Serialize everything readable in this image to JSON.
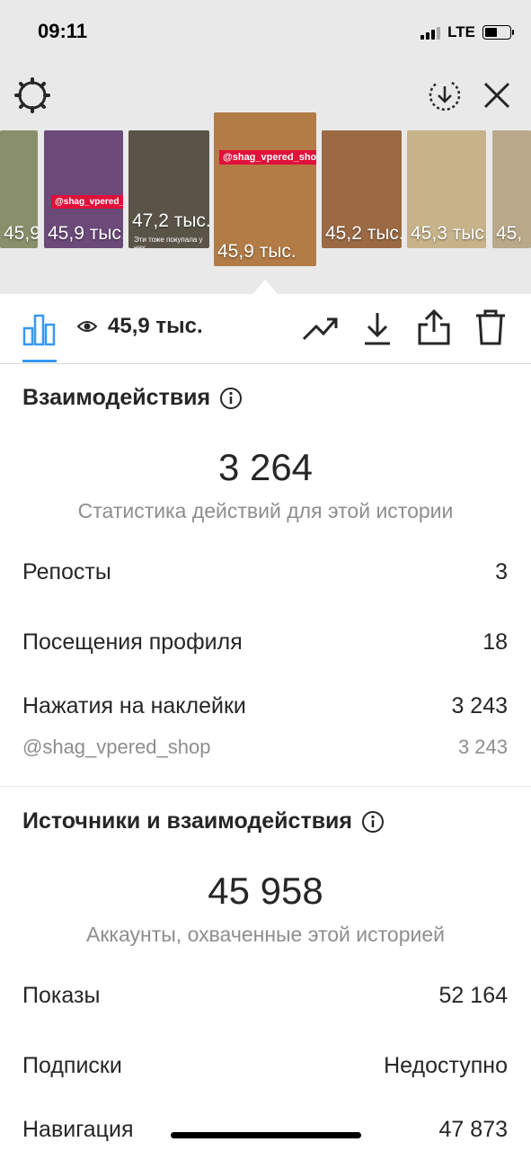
{
  "status_bar": {
    "time": "09:11",
    "network": "LTE"
  },
  "stories": [
    {
      "views": "45,9 тыс.",
      "bg": "#8a8f6b"
    },
    {
      "views": "45,9 тыс.",
      "bg": "#6b4a7a",
      "tag": "@shag_vpered_shop"
    },
    {
      "views": "47,2 тыс.",
      "bg": "#5a5448",
      "caption": "Эти тоже покупала у них"
    },
    {
      "views": "45,9 тыс.",
      "bg": "#b37b45",
      "tag": "@shag_vpered_shop",
      "active": true
    },
    {
      "views": "45,2 тыс.",
      "bg": "#9b6a44"
    },
    {
      "views": "45,3 тыс.",
      "bg": "#c7b38a"
    },
    {
      "views": "45,",
      "bg": "#b9a98a"
    }
  ],
  "toolbar": {
    "views": "45,9 тыс."
  },
  "interactions": {
    "title": "Взаимодействия",
    "total": "3 264",
    "subtitle": "Статистика действий для этой истории",
    "rows": [
      {
        "label": "Репосты",
        "value": "3"
      },
      {
        "label": "Посещения профиля",
        "value": "18"
      },
      {
        "label": "Нажатия на наклейки",
        "value": "3 243"
      }
    ],
    "sticker_detail": {
      "label": "@shag_vpered_shop",
      "value": "3 243"
    }
  },
  "discovery": {
    "title": "Источники и взаимодействия",
    "total": "45 958",
    "subtitle": "Аккаунты, охваченные этой историей",
    "rows": [
      {
        "label": "Показы",
        "value": "52 164"
      },
      {
        "label": "Подписки",
        "value": "Недоступно"
      },
      {
        "label": "Навигация",
        "value": "47 873"
      }
    ]
  }
}
